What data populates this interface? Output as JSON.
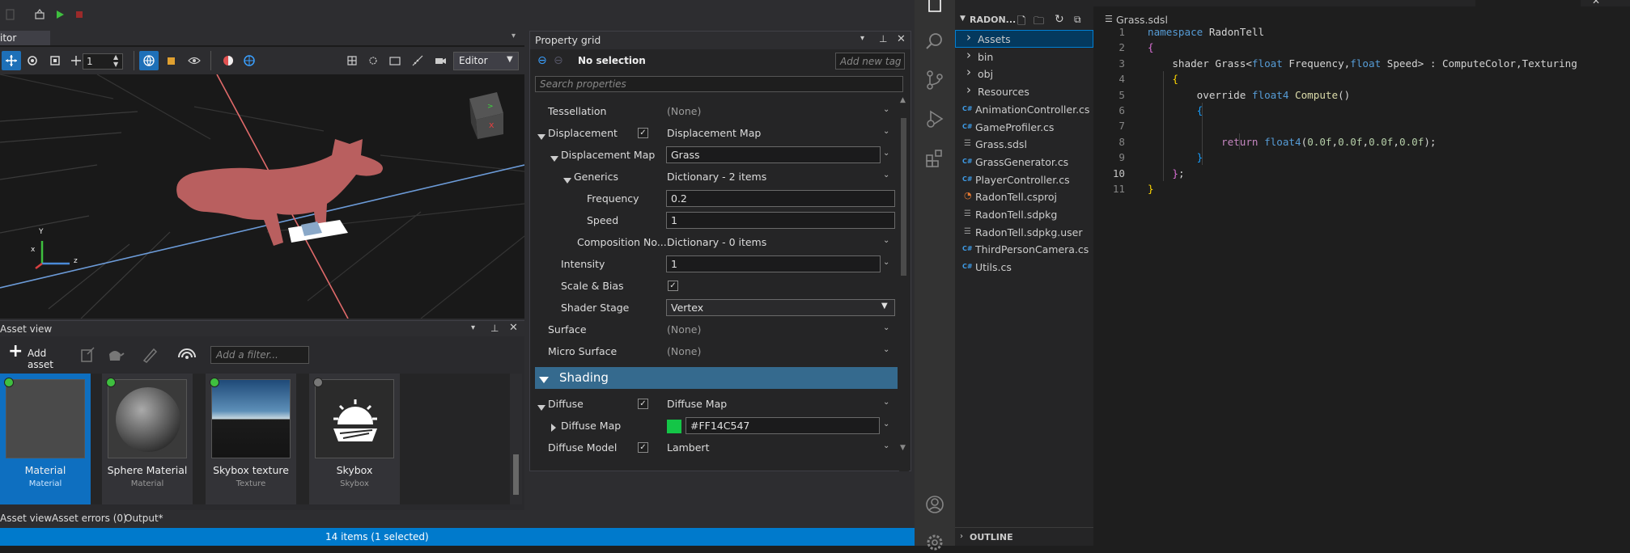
{
  "editor_tab": {
    "label": "itor"
  },
  "viewport": {
    "spinner_value": "1",
    "camera_mode": "Editor",
    "gizmo_axes": {
      "x": "x",
      "y": "Y",
      "z": "z"
    }
  },
  "property_grid": {
    "title": "Property grid",
    "selection": "No selection",
    "tag_placeholder": "Add new tag",
    "search_placeholder": "Search properties",
    "rows": [
      {
        "label": "Tessellation",
        "value": "(None)"
      },
      {
        "label": "Displacement",
        "value": "Displacement Map",
        "checked": true
      },
      {
        "label": "Displacement Map",
        "value": "Grass"
      },
      {
        "label": "Generics",
        "value": "Dictionary - 2 items"
      },
      {
        "label": "Frequency",
        "value": "0.2"
      },
      {
        "label": "Speed",
        "value": "1"
      },
      {
        "label": "Composition No...",
        "value": "Dictionary - 0 items"
      },
      {
        "label": "Intensity",
        "value": "1"
      },
      {
        "label": "Scale & Bias",
        "checked": true
      },
      {
        "label": "Shader Stage",
        "value": "Vertex"
      },
      {
        "label": "Surface",
        "value": "(None)"
      },
      {
        "label": "Micro Surface",
        "value": "(None)"
      }
    ],
    "section_shading": "Shading",
    "shading_rows": [
      {
        "label": "Diffuse",
        "value": "Diffuse Map",
        "checked": true
      },
      {
        "label": "Diffuse Map",
        "value": "#FF14C547",
        "swatch": "#14c547"
      },
      {
        "label": "Diffuse Model",
        "value": "Lambert",
        "checked": true
      }
    ]
  },
  "asset_view": {
    "title": "Asset view",
    "add_asset": "Add asset",
    "filter_placeholder": "Add a filter...",
    "assets": [
      {
        "name": "Material",
        "type": "Material",
        "selected": true,
        "status": "green"
      },
      {
        "name": "Sphere Material",
        "type": "Material",
        "selected": false,
        "status": "green"
      },
      {
        "name": "Skybox texture",
        "type": "Texture",
        "selected": false,
        "status": "green"
      },
      {
        "name": "Skybox",
        "type": "Skybox",
        "selected": false,
        "status": "gray"
      }
    ]
  },
  "bottom_tabs": [
    "Asset view",
    "Asset errors (0)",
    "Output*"
  ],
  "status_bar": {
    "text": "14 items (1 selected)"
  },
  "vscode": {
    "explorer_title": "RADON...",
    "tree": [
      {
        "label": "Assets",
        "kind": "folder",
        "selected": true
      },
      {
        "label": "bin",
        "kind": "folder"
      },
      {
        "label": "obj",
        "kind": "folder"
      },
      {
        "label": "Resources",
        "kind": "folder"
      },
      {
        "label": "AnimationController.cs",
        "kind": "cs"
      },
      {
        "label": "GameProfiler.cs",
        "kind": "cs"
      },
      {
        "label": "Grass.sdsl",
        "kind": "file"
      },
      {
        "label": "GrassGenerator.cs",
        "kind": "cs"
      },
      {
        "label": "PlayerController.cs",
        "kind": "cs"
      },
      {
        "label": "RadonTell.csproj",
        "kind": "rss"
      },
      {
        "label": "RadonTell.sdpkg",
        "kind": "file"
      },
      {
        "label": "RadonTell.sdpkg.user",
        "kind": "file"
      },
      {
        "label": "ThirdPersonCamera.cs",
        "kind": "cs"
      },
      {
        "label": "Utils.cs",
        "kind": "cs"
      }
    ],
    "outline_label": "OUTLINE",
    "breadcrumb": "Grass.sdsl",
    "tabs": [
      "GrassGenerator.cs",
      "PlayerController.cs",
      "ThirdPersonCamera.cs",
      "Grass.sdsl"
    ],
    "code_lines": [
      "namespace RadonTell",
      "{",
      "    shader Grass<float Frequency,float Speed> : ComputeColor,Texturing",
      "    {",
      "        override float4 Compute()",
      "        {",
      "",
      "            return float4(0.0f,0.0f,0.0f,0.0f);",
      "        }",
      "    };",
      "}"
    ],
    "line_numbers": [
      "1",
      "2",
      "3",
      "4",
      "5",
      "6",
      "7",
      "8",
      "9",
      "10",
      "11"
    ]
  }
}
